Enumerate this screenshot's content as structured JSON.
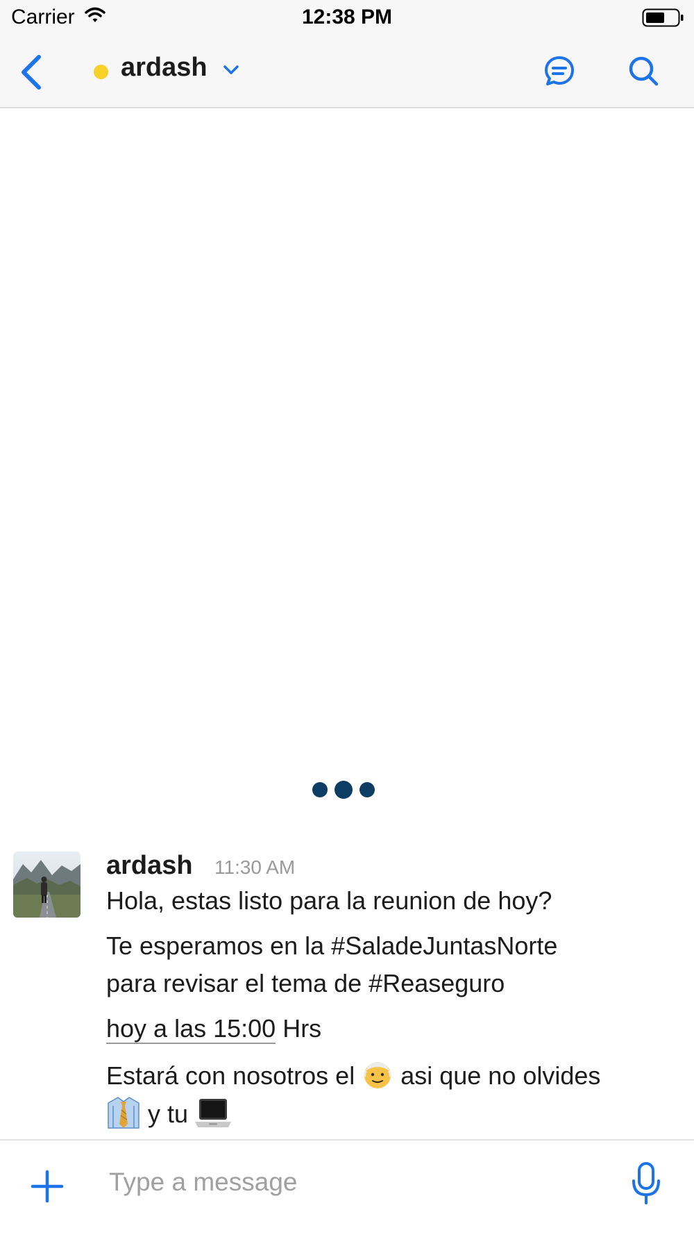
{
  "status_bar": {
    "carrier": "Carrier",
    "time": "12:38 PM"
  },
  "header": {
    "channel_name": "ardash",
    "presence_color": "#f7d02a",
    "accent_color": "#1d73e8",
    "icons": [
      "back-chevron-icon",
      "chevron-down-icon",
      "threads-icon",
      "search-icon"
    ]
  },
  "typing_indicator": {
    "dots": 3,
    "color": "#0d3d62"
  },
  "message": {
    "author": "ardash",
    "time": "11:30 AM",
    "lines": {
      "l1": "Hola, estas listo para la reunion de hoy?",
      "l2": "Te esperamos en la #SaladeJuntasNorte",
      "l3": "para revisar el tema de #Reaseguro",
      "l4_underlined": "hoy a las 15:00",
      "l4_rest": " Hrs",
      "l5_a": "Estará con nosotros el ",
      "l5_b": " asi que no olvides",
      "l6": " y tu "
    },
    "emojis": [
      "older-man-emoji",
      "necktie-emoji",
      "laptop-emoji"
    ]
  },
  "composer": {
    "placeholder": "Type a message",
    "icons": [
      "plus-icon",
      "microphone-icon"
    ]
  }
}
